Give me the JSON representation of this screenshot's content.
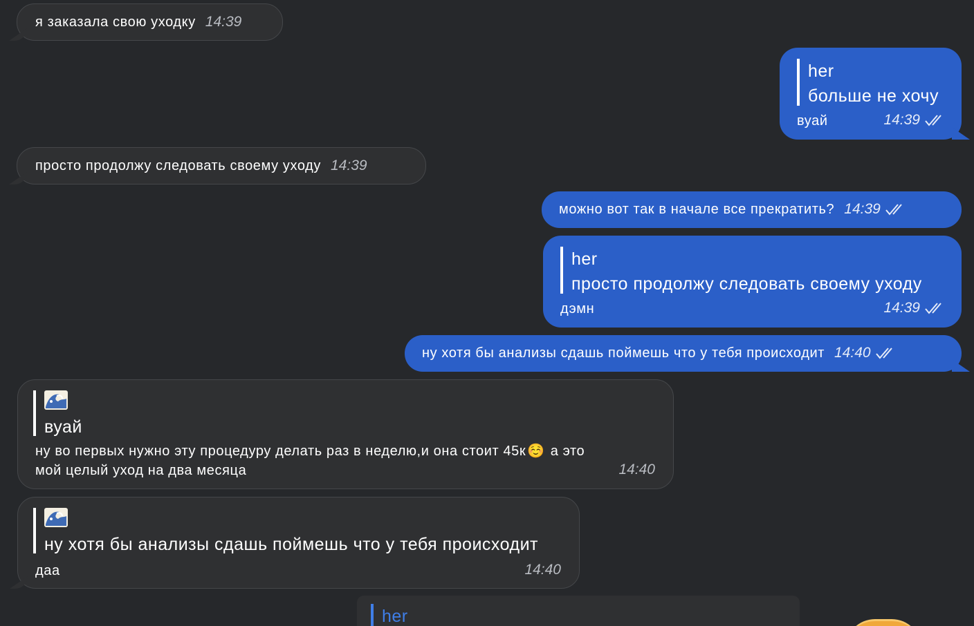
{
  "messages": [
    {
      "dir": "in",
      "text": "я заказала свою уходку",
      "time": "14:39"
    },
    {
      "dir": "out",
      "reply_author": "her",
      "reply_text": "больше не хочу",
      "text": "вуай",
      "time": "14:39"
    },
    {
      "dir": "in",
      "text": "просто продолжу следовать своему уходу",
      "time": "14:39"
    },
    {
      "dir": "out",
      "text": "можно вот так в начале все прекратить?",
      "time": "14:39"
    },
    {
      "dir": "out",
      "reply_author": "her",
      "reply_text": "просто продолжу следовать своему уходу",
      "text": "дэмн",
      "time": "14:39"
    },
    {
      "dir": "out",
      "text": "ну хотя бы анализы сдашь поймешь что у тебя происходит",
      "time": "14:40"
    },
    {
      "dir": "in",
      "reply_author_icon": "wave-emoji-icon",
      "reply_text": "вуай",
      "text_line1": "ну во первых нужно эту процедуру делать раз в неделю,и она стоит 45к",
      "emoji": "☺️",
      "text_line1_end": "а это",
      "text_line2": "мой целый уход на два месяца",
      "time": "14:40"
    },
    {
      "dir": "in",
      "reply_author_icon": "wave-emoji-icon",
      "reply_text": "ну хотя бы анализы сдашь поймешь что у тебя происходит",
      "text": "даа",
      "time": "14:40"
    }
  ],
  "partial_reply": {
    "author": "her"
  },
  "colors": {
    "background": "#26282b",
    "incoming_bubble": "#2f3032",
    "outgoing_bubble": "#2b5fc8",
    "reply_author_accent": "#3f7ee8",
    "read_ticks": "#e6ecf8"
  }
}
